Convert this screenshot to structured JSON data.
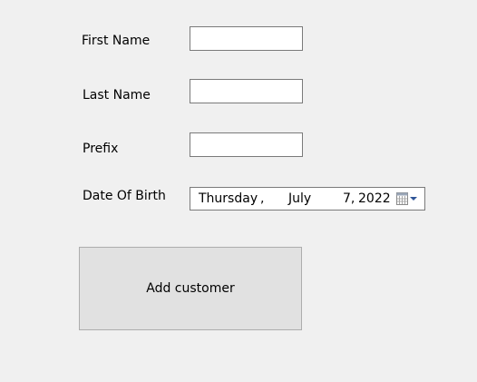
{
  "form": {
    "first_name": {
      "label": "First Name",
      "value": ""
    },
    "last_name": {
      "label": "Last Name",
      "value": ""
    },
    "prefix": {
      "label": "Prefix",
      "value": ""
    },
    "date_of_birth": {
      "label": "Date Of Birth",
      "weekday": "Thursday",
      "separator": ",",
      "month": "July",
      "day": "7,",
      "year": "2022",
      "dropdown_icon": "calendar-dropdown-icon"
    },
    "add_customer_label": "Add customer"
  }
}
